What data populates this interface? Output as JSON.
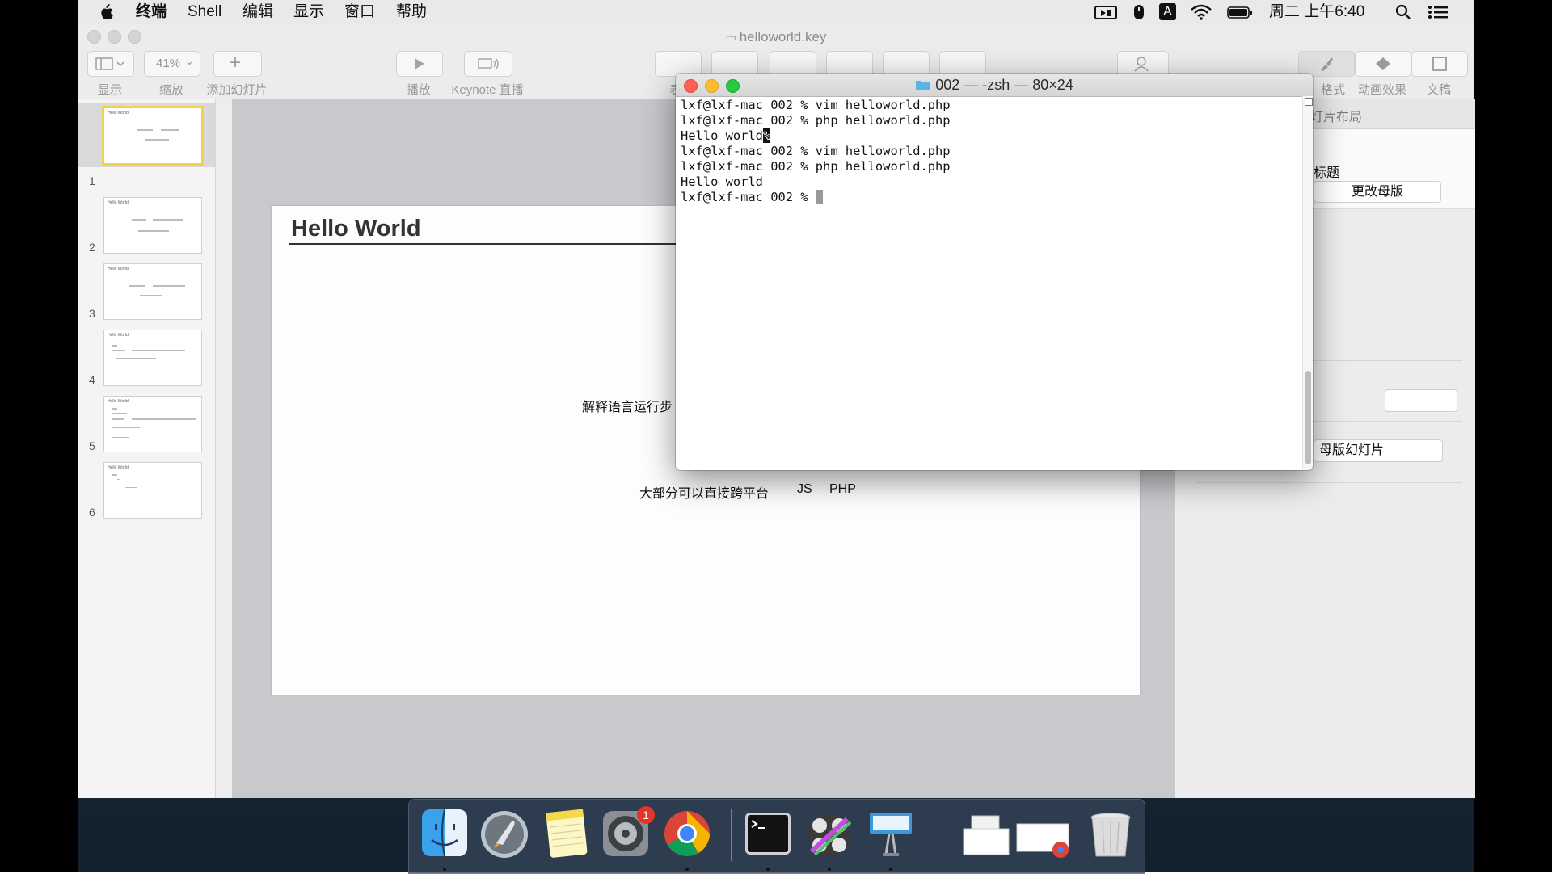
{
  "menubar": {
    "items": [
      "终端",
      "Shell",
      "编辑",
      "显示",
      "窗口",
      "帮助"
    ],
    "input_method": "A",
    "clock": "周二 上午6:40"
  },
  "keynote": {
    "title": "helloworld.key",
    "toolbar": {
      "view_label": "显示",
      "zoom_value": "41%",
      "zoom_label": "缩放",
      "add_slide_label": "添加幻灯片",
      "play_label": "播放",
      "keynote_live_label": "Keynote 直播",
      "table_label_partial": "表",
      "format_label": "格式",
      "animate_label": "动画效果",
      "document_label": "文稿"
    },
    "slides": [
      {
        "num": "1",
        "title": "Hello World"
      },
      {
        "num": "2",
        "title": "Hello World"
      },
      {
        "num": "3",
        "title": "Hello World"
      },
      {
        "num": "4",
        "title": "Hello World"
      },
      {
        "num": "5",
        "title": "Hello World"
      },
      {
        "num": "6",
        "title": "Hello World"
      }
    ],
    "slide": {
      "title": "Hello World",
      "text1": "解释语言运行步",
      "text2": "大部分可以直接跨平台",
      "text3": "JS",
      "text4": "PHP"
    },
    "inspector": {
      "layout_header": "灯片布局",
      "title_label": "标题",
      "change_master_button": "更改母版",
      "master_slides_label": "母版幻灯片"
    }
  },
  "terminal": {
    "title": "002 — -zsh — 80×24",
    "lines": [
      "lxf@lxf-mac 002 % vim helloworld.php",
      "lxf@lxf-mac 002 % php helloworld.php",
      "Hello world",
      "lxf@lxf-mac 002 % vim helloworld.php",
      "lxf@lxf-mac 002 % php helloworld.php",
      "Hello world",
      "lxf@lxf-mac 002 % "
    ],
    "no_newline_marker": "%"
  },
  "dock": {
    "badge_count": "1",
    "apps": [
      "finder-icon",
      "launchpad-icon",
      "notes-icon",
      "system-preferences-icon",
      "chrome-icon",
      "terminal-icon",
      "photo-booth-icon",
      "keynote-icon",
      "documents-stack-icon",
      "downloads-stack-icon",
      "trash-icon"
    ]
  },
  "colors": {
    "traffic_red": "#fe5f57",
    "traffic_yellow": "#febc2e",
    "traffic_green": "#28c840",
    "selected_slide": "#f1d449",
    "badge_red": "#e6332a"
  }
}
